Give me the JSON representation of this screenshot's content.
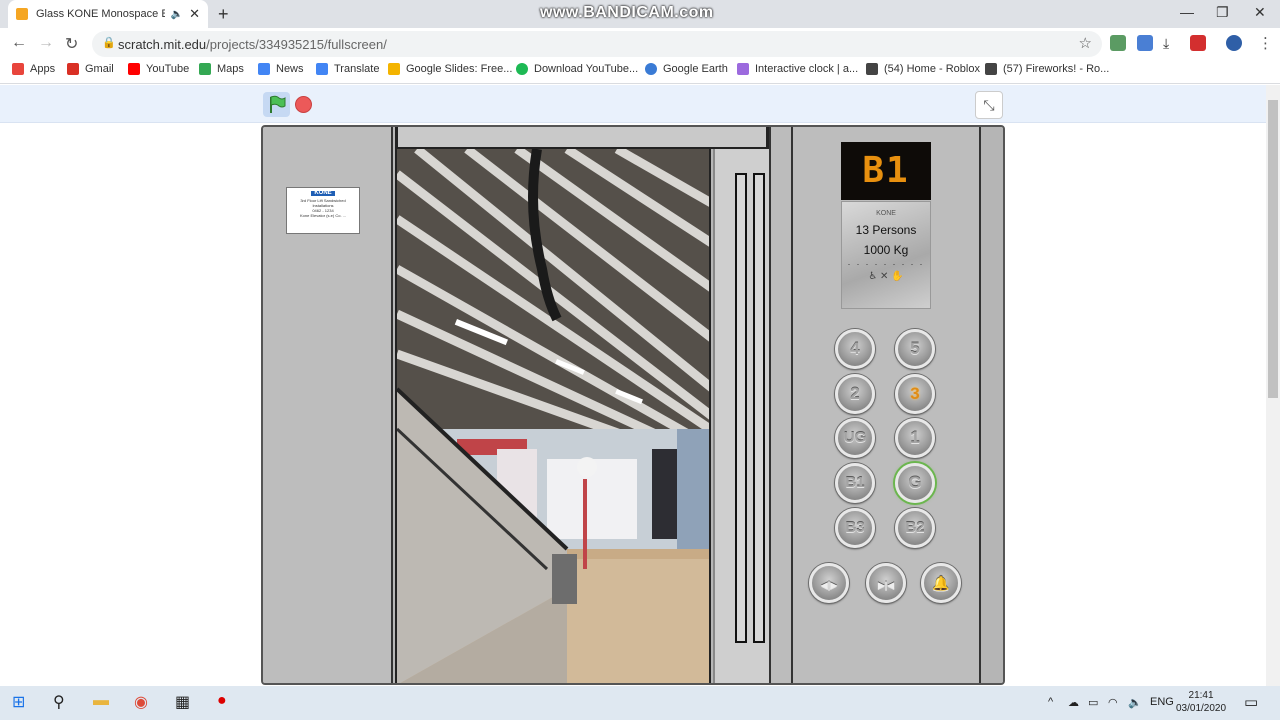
{
  "browser": {
    "tab_title": "Glass KONE Monospace Elev",
    "audio_icon": "speaker-icon",
    "close": "✕",
    "new_tab": "+",
    "watermark": "www.BANDICAM.com",
    "url_host": "scratch.mit.edu",
    "url_path": "/projects/334935215/fullscreen/",
    "window_controls": [
      "—",
      "❐",
      "✕"
    ]
  },
  "bookmarks": [
    {
      "label": "Apps",
      "color": "#e8453c"
    },
    {
      "label": "Gmail",
      "color": "#d93025"
    },
    {
      "label": "YouTube",
      "color": "#ff0000"
    },
    {
      "label": "Maps",
      "color": "#34a853"
    },
    {
      "label": "News",
      "color": "#4285f4"
    },
    {
      "label": "Translate",
      "color": "#4285f4"
    },
    {
      "label": "Google Slides: Free...",
      "color": "#f4b400"
    },
    {
      "label": "Download YouTube...",
      "color": "#1db954"
    },
    {
      "label": "Google Earth",
      "color": "#3a7bd5"
    },
    {
      "label": "Interactive clock | a...",
      "color": "#9c6ade"
    },
    {
      "label": "(54) Home - Roblox",
      "color": "#444444"
    },
    {
      "label": "(57) Fireworks! - Ro...",
      "color": "#444444"
    }
  ],
  "elevator": {
    "floor_display": "B1",
    "plate_logo": "KONE",
    "plate_lines": [
      "3rd Floor Lift Sandwiched",
      "Installations",
      "0462 - 1234",
      "Kone Elevator (s.e) Co. ..."
    ],
    "cap_brand": "KONE",
    "capacity_persons": "13 Persons",
    "capacity_weight": "1000 Kg",
    "cap_dots": ". . . . . . . . .",
    "cap_icons": "♿ ✕ ✋",
    "buttons": [
      {
        "label": "4",
        "state": "off"
      },
      {
        "label": "5",
        "state": "off"
      },
      {
        "label": "2",
        "state": "off"
      },
      {
        "label": "3",
        "state": "lit-orange"
      },
      {
        "label": "UG",
        "state": "off"
      },
      {
        "label": "1",
        "state": "off"
      },
      {
        "label": "B1",
        "state": "off"
      },
      {
        "label": "G",
        "state": "lit-green"
      },
      {
        "label": "B3",
        "state": "off"
      },
      {
        "label": "B2",
        "state": "off"
      }
    ],
    "door_open_symbol": "◀|▶",
    "door_close_symbol": "▶|◀",
    "alarm_symbol": "🔔"
  },
  "taskbar": {
    "language": "ENG",
    "time": "21:41",
    "date": "03/01/2020"
  }
}
